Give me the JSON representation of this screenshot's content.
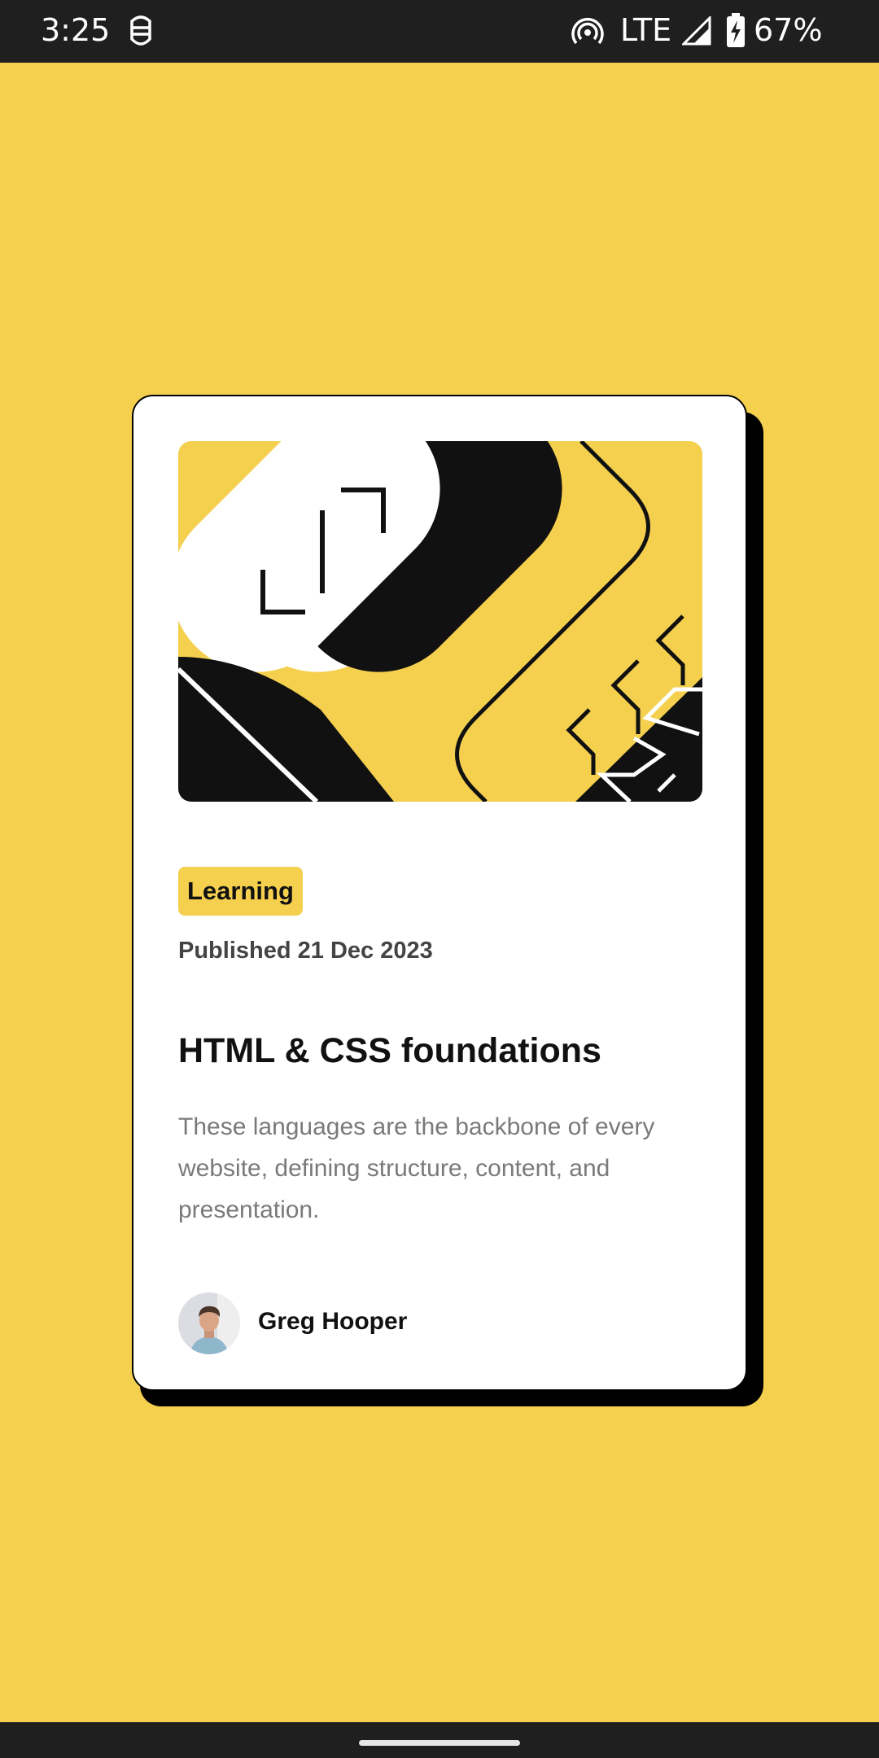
{
  "status_bar": {
    "time": "3:25",
    "network": "LTE",
    "battery": "67%",
    "icons": [
      "app-notification-icon",
      "hotspot-icon",
      "signal-icon",
      "battery-charging-icon"
    ]
  },
  "card": {
    "tag": "Learning",
    "published": "Published 21 Dec 2023",
    "title": "HTML & CSS foundations",
    "description": "These languages are the backbone of every website, defining structure, content, and presentation.",
    "author": "Greg Hooper"
  },
  "colors": {
    "background": "#f4d04e",
    "card": "#ffffff",
    "ink": "#111111",
    "muted": "#7a7a7a",
    "system_bar": "#1f1f1f"
  }
}
